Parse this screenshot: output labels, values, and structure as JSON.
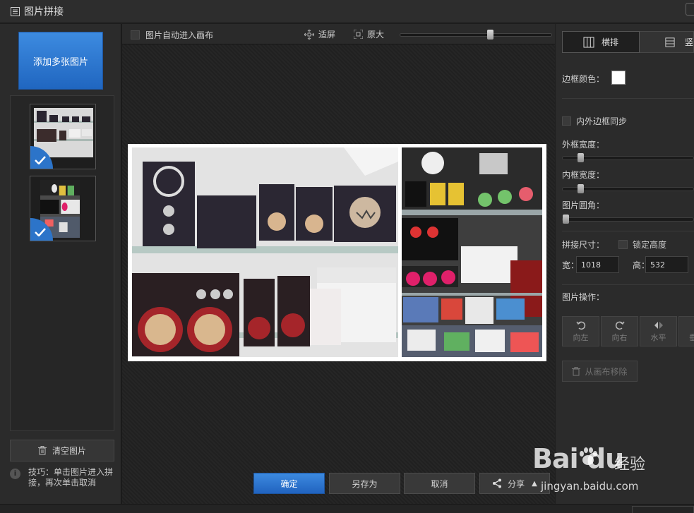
{
  "window": {
    "title": "图片拼接"
  },
  "left": {
    "add_button": "添加多张图片",
    "thumbnails": [
      {
        "selected": true
      },
      {
        "selected": true
      }
    ],
    "clear_button": "清空图片",
    "tip": "技巧：单击图片进入拼接，再次单击取消"
  },
  "toolbar": {
    "auto_enter_label": "图片自动进入画布",
    "fit_label": "适屏",
    "original_label": "原大",
    "zoom_fraction": 0.6
  },
  "bottom": {
    "confirm": "确定",
    "save_as": "另存为",
    "cancel": "取消",
    "share": "分享"
  },
  "right": {
    "tab_horizontal": "横排",
    "tab_vertical": "竖",
    "border_color_label": "边框颜色：",
    "border_color": "#ffffff",
    "sync_label": "内外边框同步",
    "outer_width_label": "外框宽度：",
    "outer_width_fraction": 0.12,
    "inner_width_label": "内框宽度：",
    "inner_width_fraction": 0.12,
    "corner_label": "图片圆角：",
    "corner_fraction": 0.0,
    "size_label": "拼接尺寸：",
    "lock_height_label": "锁定高度",
    "width_label": "宽：",
    "width_value": "1018",
    "height_label": "高：",
    "height_value": "532",
    "ops_label": "图片操作：",
    "rotate_left": "向左",
    "rotate_right": "向右",
    "flip_horizontal": "水平",
    "flip_vertical": "垂",
    "remove_from_canvas": "从画布移除"
  },
  "watermark": {
    "logo": "Bai du",
    "cn": "经验",
    "url": "jingyan.baidu.com"
  }
}
